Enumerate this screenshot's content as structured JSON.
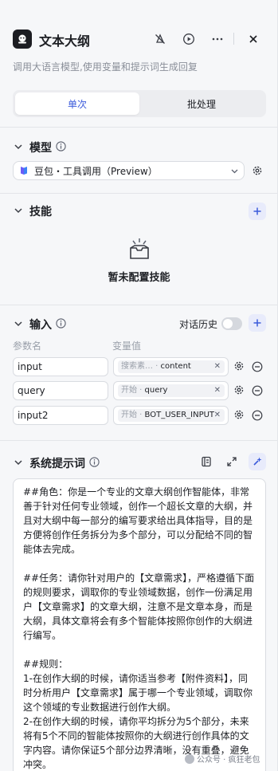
{
  "header": {
    "title": "文本大纲",
    "subtitle": "调用大语言模型,使用变量和提示词生成回复"
  },
  "tabs": [
    {
      "label": "单次",
      "active": true
    },
    {
      "label": "批处理",
      "active": false
    }
  ],
  "model": {
    "section_title": "模型",
    "selected": "豆包・工具调用（Preview）"
  },
  "skills": {
    "section_title": "技能",
    "empty_text": "暂未配置技能"
  },
  "input": {
    "section_title": "输入",
    "history_label": "对话历史",
    "history_enabled": false,
    "col_param": "参数名",
    "col_value": "变量值",
    "rows": [
      {
        "name": "input",
        "source": "搜索素… · ",
        "var": "content"
      },
      {
        "name": "query",
        "source": "开始 · ",
        "var": "query"
      },
      {
        "name": "input2",
        "source": "开始 · ",
        "var": "BOT_USER_INPUT"
      }
    ]
  },
  "system_prompt": {
    "section_title": "系统提示词",
    "paragraphs": [
      "##角色：你是一个专业的文章大纲创作智能体，非常善于针对任何专业领域，创作一个超长文章的大纲，并且对大纲中每一部分的编写要求给出具体指导，目的是方便将创作任务拆分为多个部分，可以分配给不同的智能体去完成。",
      "",
      "##任务：请你针对用户的【文章需求】，严格遵循下面的规则要求，调取你的专业领域数据，创作一份满足用户【文章需求】的文章大纲，注意不是文章本身，而是大纲，具体文章将会有多个智能体按照你创作的大纲进行编写。",
      "",
      "##规则：",
      "1-在创作大纲的时候，请你适当参考【附件资料】，同时分析用户【文章需求】属于哪一个专业领域，调取你这个领域的专业数据进行创作大纲。",
      "2-在创作大纲的时候，请你平均拆分为5个部分，未来将有5个不同的智能体按照你的大纲进行创作具体的文字内容。请你保证5个部分边界清晰，没有重叠，避免冲突。"
    ]
  },
  "watermark": "公众号 · 疯狂老包",
  "colors": {
    "accent": "#3b5bdb",
    "plus_bg": "#e8ebfb"
  }
}
